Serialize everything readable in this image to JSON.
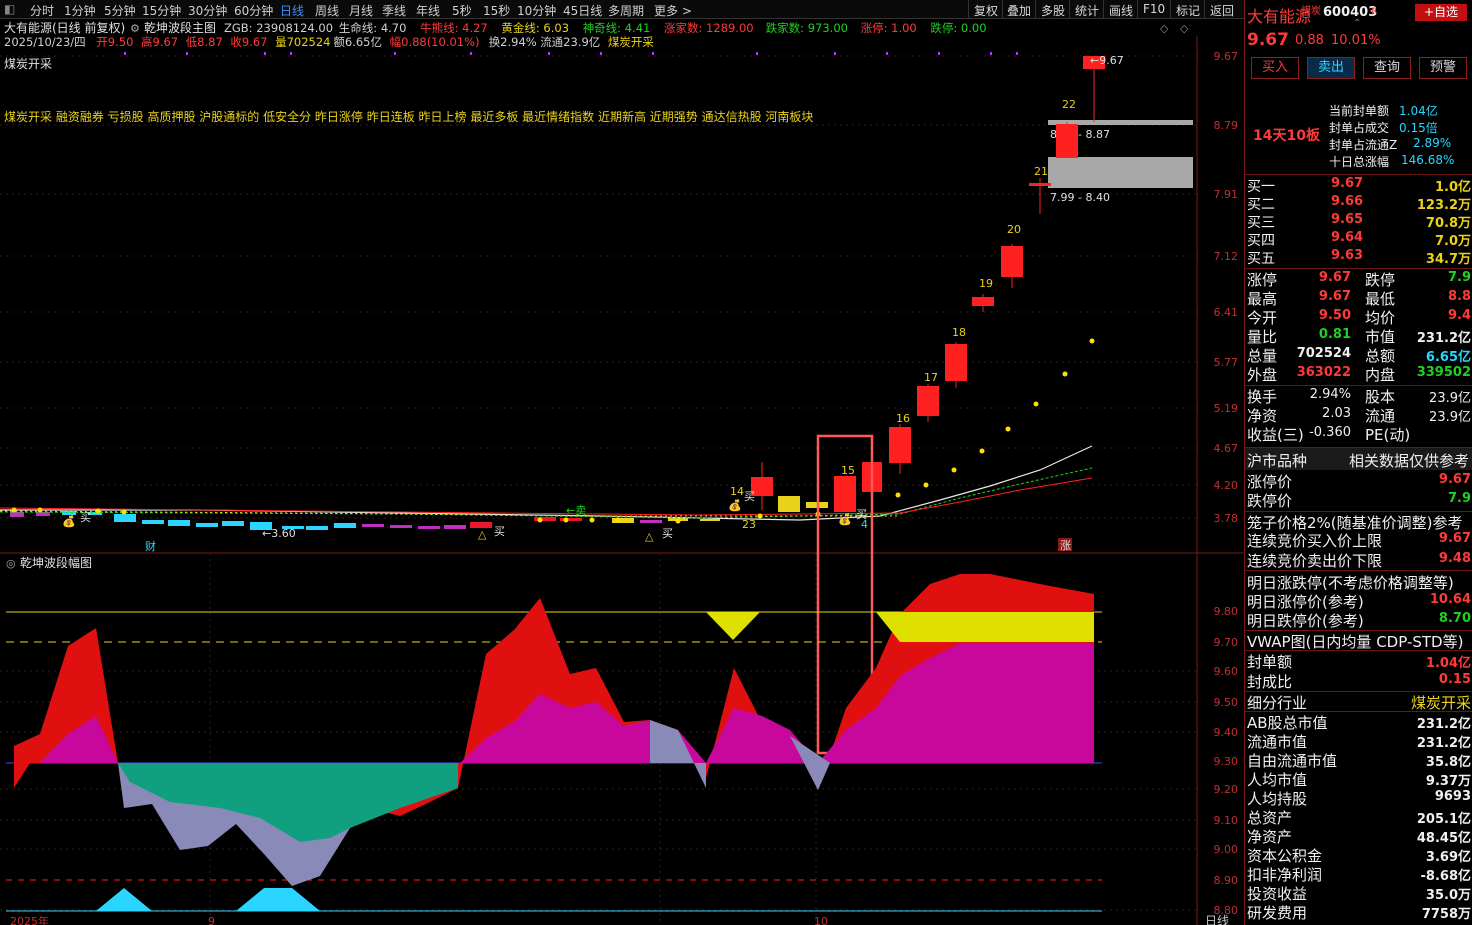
{
  "toolbar": {
    "periods": [
      "分时",
      "1分钟",
      "5分钟",
      "15分钟",
      "30分钟",
      "60分钟",
      "日线",
      "周线",
      "月线",
      "季线",
      "年线",
      "5秒",
      "15秒",
      "10分钟",
      "45日线",
      "多周期",
      "更多 >"
    ],
    "active": "日线",
    "right": [
      "复权",
      "叠加",
      "多股",
      "统计",
      "画线",
      "F10",
      "标记",
      "返回"
    ]
  },
  "chart": {
    "title": "大有能源(日线 前复权)",
    "indicator_name": "乾坤波段主图",
    "stats": [
      {
        "text": "ZGB: 23908124.00",
        "color": "#d0d0d0"
      },
      {
        "text": "生命线: 4.70",
        "color": "#d0d0d0"
      },
      {
        "text": "牛熊线: 4.27",
        "color": "#ff3a3a"
      },
      {
        "text": "黄金线: 6.03",
        "color": "#e8d21a"
      },
      {
        "text": "神奇线: 4.41",
        "color": "#1fd11f"
      },
      {
        "text": "涨家数: 1289.00",
        "color": "#ff3a3a"
      },
      {
        "text": "跌家数: 973.00",
        "color": "#1fd11f"
      },
      {
        "text": "涨停: 1.00",
        "color": "#ff3a3a"
      },
      {
        "text": "跌停: 0.00",
        "color": "#1fd11f"
      }
    ],
    "date_line": [
      {
        "text": "2025/10/23/四",
        "color": "#d0d0d0"
      },
      {
        "text": "开9.50",
        "color": "#ff3a3a"
      },
      {
        "text": "高9.67",
        "color": "#ff3a3a"
      },
      {
        "text": "低8.87",
        "color": "#ff3a3a"
      },
      {
        "text": "收9.67",
        "color": "#ff3a3a"
      },
      {
        "text": "量702524",
        "color": "#e8d21a"
      },
      {
        "text": "额6.65亿",
        "color": "#d0d0d0"
      },
      {
        "text": "幅0.88(10.01%)",
        "color": "#ff3a3a"
      },
      {
        "text": "换2.94%",
        "color": "#d0d0d0"
      },
      {
        "text": "流通23.9亿",
        "color": "#d0d0d0"
      },
      {
        "text": "煤炭开采",
        "color": "#e8d21a"
      }
    ],
    "industry": "煤炭开采",
    "concepts": "煤炭开采 融资融券 亏损股 高质押股 沪股通标的 低安全分 昨日涨停 昨日连板 昨日上榜 最近多板 最近情绪指数 近期新高 近期强势 通达信热股 河南板块",
    "price_axis": [
      "9.67",
      "8.79",
      "7.91",
      "7.12",
      "6.41",
      "5.77",
      "5.19",
      "4.67",
      "4.20",
      "3.78"
    ],
    "sub_axis": [
      "9.80",
      "9.70",
      "9.60",
      "9.50",
      "9.40",
      "9.30",
      "9.20",
      "9.10",
      "9.00",
      "8.90",
      "8.80"
    ],
    "sub_title": "乾坤波段幅图",
    "labels": {
      "high_price": "9.67",
      "range_high": "8.79 - 8.87",
      "range_low": "7.99 - 8.40",
      "low_price": "3.60",
      "sell": "卖",
      "buy": "买",
      "cai": "财",
      "zhang": "涨",
      "day_nums": [
        "14",
        "15",
        "16",
        "17",
        "18",
        "19",
        "20",
        "21",
        "22",
        "23",
        "4"
      ],
      "bottom_left": "2025年",
      "bottom_mid": "9",
      "bottom_right": "10",
      "corner": "日线"
    }
  },
  "panel": {
    "name": "大有能源",
    "tag": "煤炭",
    "code": "600403",
    "rz": "R",
    "add_btn": "+自选",
    "price": "9.67",
    "change": "0.88",
    "pct": "10.01%",
    "buttons": [
      "买入",
      "卖出",
      "查询",
      "预警"
    ],
    "streak": "14天10板",
    "seal": [
      {
        "label": "当前封单额",
        "value": "1.04亿"
      },
      {
        "label": "封单占成交",
        "value": "0.15倍"
      },
      {
        "label": "封单占流通Z",
        "value": "2.89%"
      },
      {
        "label": "十日总涨幅",
        "value": "146.68%"
      }
    ],
    "buy_book": [
      {
        "label": "买一",
        "price": "9.67",
        "vol": "1.0亿"
      },
      {
        "label": "买二",
        "price": "9.66",
        "vol": "123.2万"
      },
      {
        "label": "买三",
        "price": "9.65",
        "vol": "70.8万"
      },
      {
        "label": "买四",
        "price": "9.64",
        "vol": "7.0万"
      },
      {
        "label": "买五",
        "price": "9.63",
        "vol": "34.7万"
      }
    ],
    "quote": [
      {
        "l1": "涨停",
        "v1": "9.67",
        "c1": "red",
        "l2": "跌停",
        "v2": "7.9",
        "c2": "green"
      },
      {
        "l1": "最高",
        "v1": "9.67",
        "c1": "red",
        "l2": "最低",
        "v2": "8.8",
        "c2": "red"
      },
      {
        "l1": "今开",
        "v1": "9.50",
        "c1": "red",
        "l2": "均价",
        "v2": "9.4",
        "c2": "red"
      },
      {
        "l1": "量比",
        "v1": "0.81",
        "c1": "green",
        "l2": "市值",
        "v2": "231.2亿",
        "c2": "white"
      },
      {
        "l1": "总量",
        "v1": "702524",
        "c1": "white",
        "l2": "总额",
        "v2": "6.65亿",
        "c2": "cyan"
      },
      {
        "l1": "外盘",
        "v1": "363022",
        "c1": "red",
        "l2": "内盘",
        "v2": "339502",
        "c2": "green"
      }
    ],
    "quote2": [
      {
        "l1": "换手",
        "v1": "2.94%",
        "l2": "股本",
        "v2": "23.9亿"
      },
      {
        "l1": "净资",
        "v1": "2.03",
        "l2": "流通",
        "v2": "23.9亿"
      },
      {
        "l1": "收益(三)",
        "v1": "-0.360",
        "l2": "PE(动)",
        "v2": ""
      }
    ],
    "market_header": "沪市品种",
    "market_note": "相关数据仅供参考",
    "limits": [
      {
        "label": "涨停价",
        "value": "9.67",
        "color": "red"
      },
      {
        "label": "跌停价",
        "value": "7.9",
        "color": "green"
      }
    ],
    "cage": "笼子价格2%(随基准价调整)参考",
    "cage_rows": [
      {
        "label": "连续竞价买入价上限",
        "value": "9.67",
        "color": "red"
      },
      {
        "label": "连续竞价卖出价下限",
        "value": "9.48",
        "color": "red"
      }
    ],
    "tomorrow_header": "明日涨跌停(不考虑价格调整等)",
    "tomorrow": [
      {
        "label": "明日涨停价(参考)",
        "value": "10.64",
        "color": "red"
      },
      {
        "label": "明日跌停价(参考)",
        "value": "8.70",
        "color": "green"
      }
    ],
    "vwap": "VWAP图(日内均量 CDP-STD等)",
    "seal2": [
      {
        "label": "封单额",
        "value": "1.04亿",
        "color": "red"
      },
      {
        "label": "封成比",
        "value": "0.15",
        "color": "red"
      }
    ],
    "industry_label": "细分行业",
    "industry_value": "煤炭开采",
    "fund": [
      {
        "label": "AB股总市值",
        "value": "231.2亿"
      },
      {
        "label": "流通市值",
        "value": "231.2亿"
      },
      {
        "label": "自由流通市值",
        "value": "35.8亿"
      },
      {
        "label": "人均市值",
        "value": "9.37万"
      },
      {
        "label": "人均持股",
        "value": "9693"
      },
      {
        "label": "总资产",
        "value": "205.1亿"
      },
      {
        "label": "净资产",
        "value": "48.45亿"
      },
      {
        "label": "资本公积金",
        "value": "3.69亿"
      },
      {
        "label": "扣非净利润",
        "value": "-8.68亿"
      },
      {
        "label": "投资收益",
        "value": "35.0万"
      },
      {
        "label": "研发费用",
        "value": "7758万"
      }
    ]
  }
}
